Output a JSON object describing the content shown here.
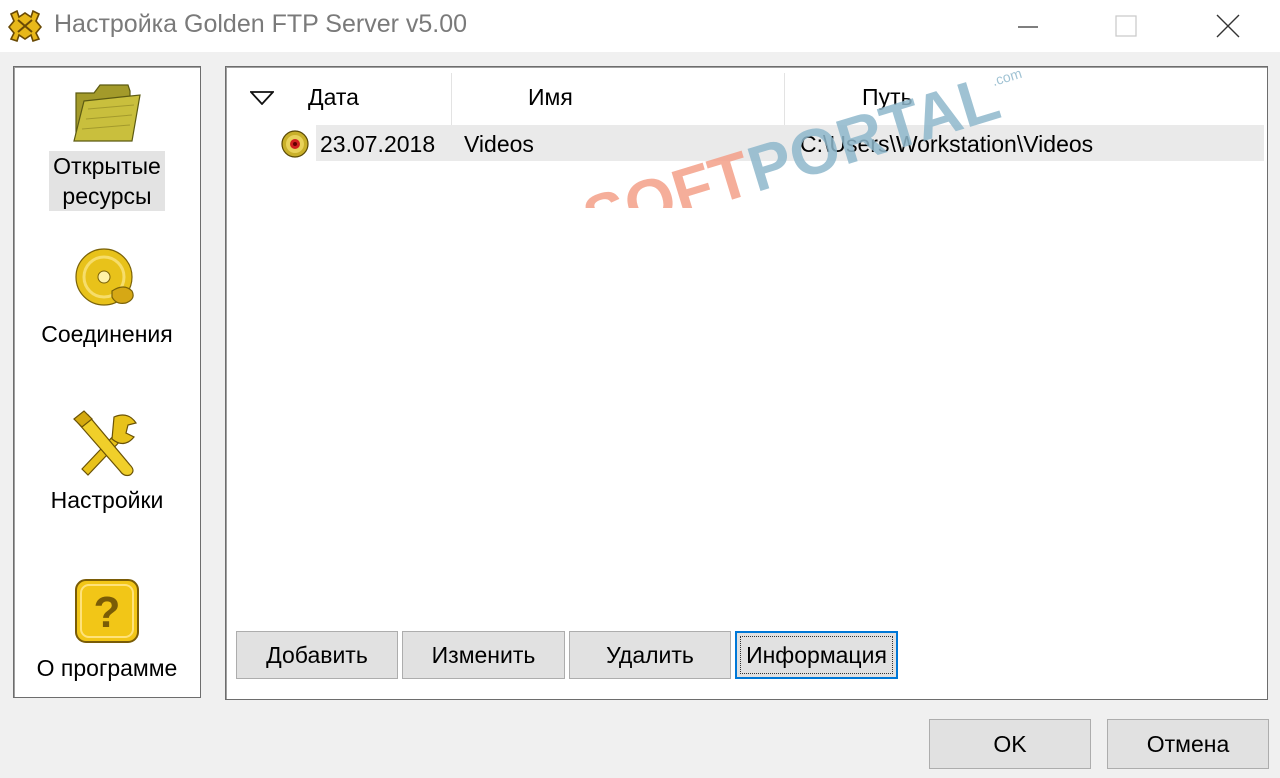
{
  "window": {
    "title": "Настройка Golden FTP Server v5.00",
    "controls": {
      "minimize": "minimize",
      "maximize": "maximize",
      "close": "close"
    }
  },
  "sidebar": {
    "items": [
      {
        "label_line1": "Открытые",
        "label_line2": "ресурсы",
        "icon": "folder-icon",
        "selected": true
      },
      {
        "label": "Соединения",
        "icon": "connections-disc-icon"
      },
      {
        "label": "Настройки",
        "icon": "tools-icon"
      },
      {
        "label": "О программе",
        "icon": "help-icon"
      }
    ]
  },
  "list": {
    "columns": [
      "Дата",
      "Имя",
      "Путь"
    ],
    "sort_indicator": "sort-descending-arrow",
    "rows": [
      {
        "date": "23.07.2018",
        "name": "Videos",
        "path": "C:\\Users\\Workstation\\Videos",
        "icon": "shared-resource-icon"
      }
    ]
  },
  "actions": {
    "add": "Добавить",
    "edit": "Изменить",
    "delete": "Удалить",
    "info": "Информация"
  },
  "footer": {
    "ok": "OK",
    "cancel": "Отмена"
  },
  "watermark": {
    "text_part1": "SOFT",
    "text_part2": "PORTAL",
    "suffix": ".com",
    "colors": {
      "soft": "#f4a089",
      "portal": "#8fb8cc"
    }
  },
  "colors": {
    "window_bg": "#f0f0f0",
    "focus_border": "#0078d7",
    "selection_bg": "#eaeaea",
    "icon_gold": "#e8c21a"
  }
}
